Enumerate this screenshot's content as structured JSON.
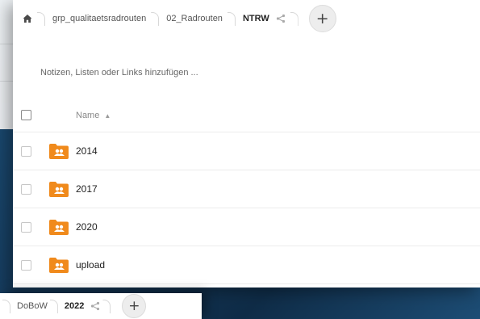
{
  "breadcrumb": {
    "items": [
      "grp_qualitaetsradrouten",
      "02_Radrouten",
      "NTRW"
    ]
  },
  "add_label": "+",
  "notes_placeholder": "Notizen, Listen oder Links hinzufügen ...",
  "table": {
    "name_header": "Name",
    "sort_indicator": "▲",
    "rows": [
      {
        "name": "2014",
        "icon": "shared-folder-icon"
      },
      {
        "name": "2017",
        "icon": "shared-folder-icon"
      },
      {
        "name": "2020",
        "icon": "shared-folder-icon"
      },
      {
        "name": "upload",
        "icon": "shared-folder-icon"
      }
    ]
  },
  "background_window": {
    "breadcrumb": [
      "DoBoW",
      "2022"
    ],
    "add_label": "+"
  },
  "colors": {
    "folder": "#f08a1c",
    "desktop": "#1c4f78"
  }
}
